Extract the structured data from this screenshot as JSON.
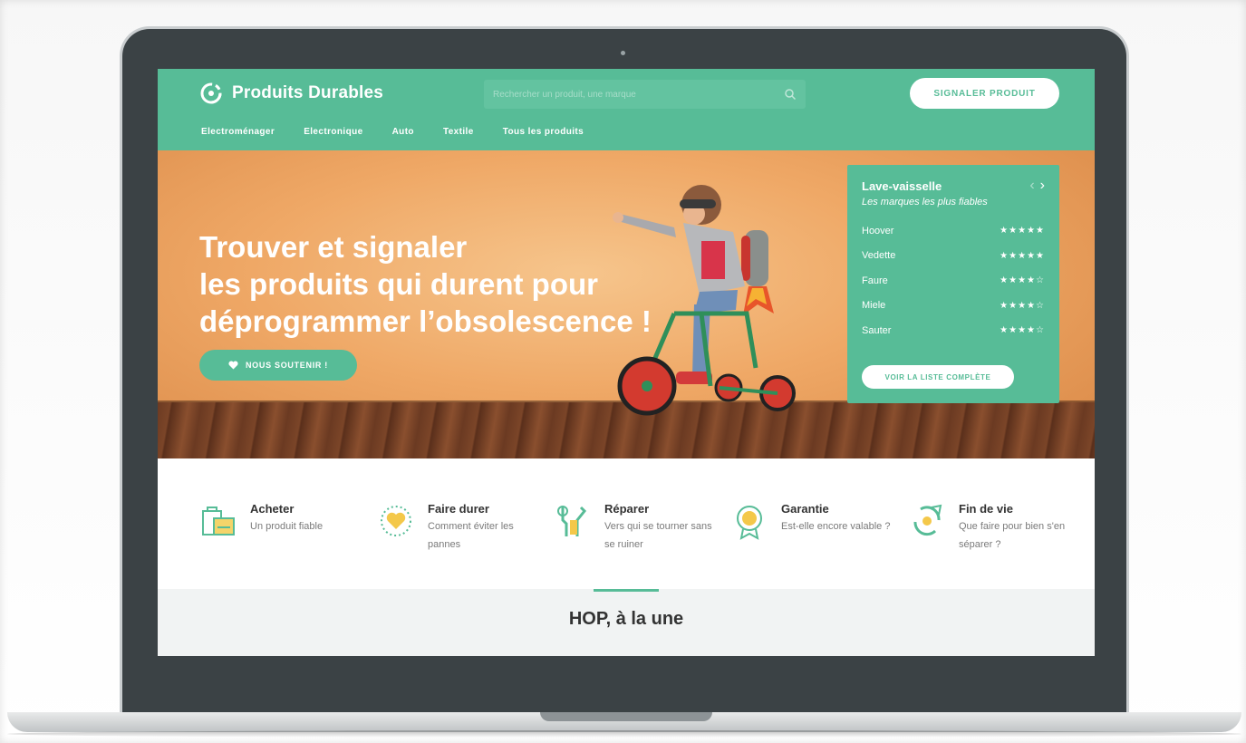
{
  "header": {
    "logo_text": "Produits Durables",
    "search_placeholder": "Rechercher un produit, une marque",
    "report_button": "SIGNALER PRODUIT",
    "nav": [
      "Electroménager",
      "Electronique",
      "Auto",
      "Textile",
      "Tous les produits"
    ]
  },
  "hero": {
    "title_line1": "Trouver et signaler",
    "title_line2": "les produits qui durent pour",
    "title_line3": "déprogrammer l’obsolescence !",
    "support_button": "NOUS SOUTENIR !"
  },
  "ranking": {
    "title": "Lave-vaisselle",
    "subtitle": "Les marques les plus fiables",
    "items": [
      {
        "brand": "Hoover",
        "stars": "★★★★★",
        "rating": 4.5
      },
      {
        "brand": "Vedette",
        "stars": "★★★★★",
        "rating": 4.5
      },
      {
        "brand": "Faure",
        "stars": "★★★★☆",
        "rating": 4
      },
      {
        "brand": "Miele",
        "stars": "★★★★☆",
        "rating": 4
      },
      {
        "brand": "Sauter",
        "stars": "★★★★☆",
        "rating": 4
      }
    ],
    "button": "VOIR LA LISTE COMPLÈTE"
  },
  "features": [
    {
      "title": "Acheter",
      "desc": "Un produit fiable",
      "icon": "shopping-bags-icon"
    },
    {
      "title": "Faire durer",
      "desc": "Comment éviter les pannes",
      "icon": "heart-sparkle-icon"
    },
    {
      "title": "Réparer",
      "desc": "Vers qui se tourner sans se ruiner",
      "icon": "tools-icon"
    },
    {
      "title": "Garantie",
      "desc": "Est-elle encore valable ?",
      "icon": "medal-icon"
    },
    {
      "title": "Fin de vie",
      "desc": "Que faire pour bien s'en séparer ?",
      "icon": "recycle-icon"
    }
  ],
  "une": {
    "title": "HOP, à la une"
  },
  "colors": {
    "accent": "#57bc97",
    "bezel": "#3b4245",
    "text": "#333333"
  }
}
